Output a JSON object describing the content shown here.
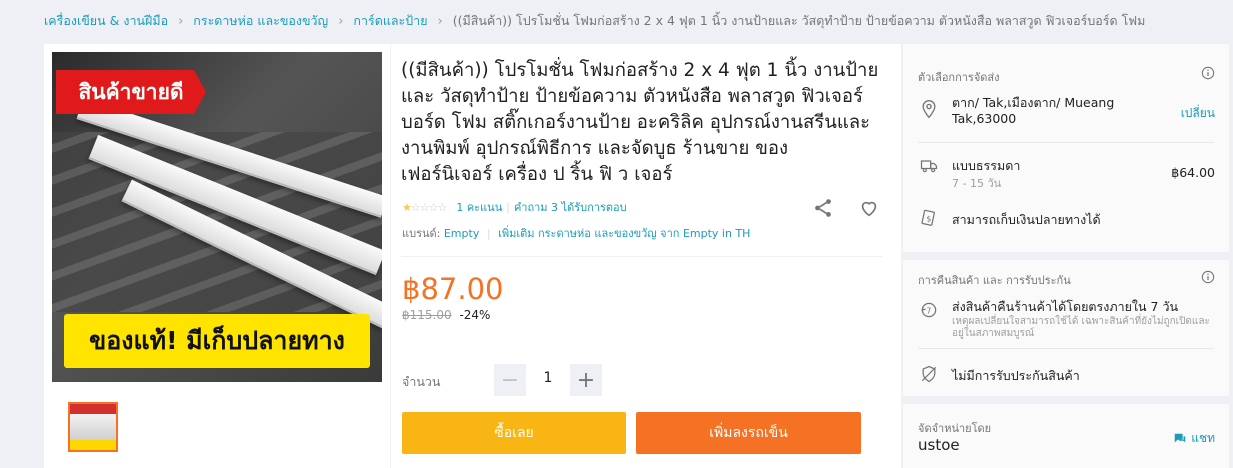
{
  "breadcrumb": {
    "items": [
      "เครื่องเขียน & งานฝีมือ",
      "กระดาษห่อ และของขวัญ",
      "การ์ดและป้าย"
    ],
    "current": "((มีสินค้า)) โปรโมชั่น โฟมก่อสร้าง 2 x 4 ฟุต 1 นิ้ว งานป้ายและ วัสดุทำป้าย ป้ายข้อความ ตัวหนังสือ พลาสวูด ฟิวเจอร์บอร์ด โฟม"
  },
  "gallery": {
    "ribbon_text": "สินค้าขายดี",
    "banner_text": "ของแท้! มีเก็บปลายทาง"
  },
  "product": {
    "title": "((มีสินค้า)) โปรโมชั่น โฟมก่อสร้าง 2 x 4 ฟุต 1 นิ้ว งานป้ายและ วัสดุทำป้าย ป้ายข้อความ ตัวหนังสือ พลาสวูด ฟิวเจอร์บอร์ด โฟม สติ๊กเกอร์งานป้าย อะคริลิค อุปกรณ์งานสรีนและงานพิมพ์ อุปกรณ์พิธีการ และจัดบูธ ร้านขาย ของ เฟอร์นิเจอร์ เครื่อง ป ริ้น ฟิ ว เจอร์",
    "rating_stars": 1,
    "rating_max": 5,
    "ratings_link": "1 คะแนน",
    "questions_link": "คำถาม 3 ได้รับการตอบ",
    "brand_label": "แบรนด์:",
    "brand_value": "Empty",
    "more_link": "เพิ่มเติม กระดาษห่อ และของขวัญ จาก Empty in TH",
    "price": "฿87.00",
    "original_price": "฿115.00",
    "discount": "-24%",
    "quantity_label": "จำนวน",
    "quantity": "1",
    "buy_now_label": "ซื้อเลย",
    "add_to_cart_label": "เพิ่มลงรถเข็น"
  },
  "delivery": {
    "section_label": "ตัวเลือกการจัดส่ง",
    "address": "ตาก/ Tak,เมืองตาก/ Mueang Tak,63000",
    "change_link": "เปลี่ยน",
    "shipping_type": "แบบธรรมดา",
    "shipping_days": "7 - 15 วัน",
    "shipping_price": "฿64.00",
    "cod_text": "สามารถเก็บเงินปลายทางได้"
  },
  "returns": {
    "section_label": "การคืนสินค้า และ การรับประกัน",
    "return_title": "ส่งสินค้าคืนร้านค้าได้โดยตรงภายใน 7 วัน",
    "return_note": "เหตุผลเปลี่ยนใจสามารถใช้ได้ เฉพาะสินค้าที่ยังไม่ถูกเปิดและอยู่ในสภาพสมบูรณ์",
    "warranty_text": "ไม่มีการรับประกันสินค้า"
  },
  "seller": {
    "section_label": "จัดจำหน่ายโดย",
    "name": "ustoe",
    "chat_label": "แชท"
  },
  "colors": {
    "link": "#1a9cb7",
    "price": "#f57224",
    "buy_now": "#f8b514",
    "add_to_cart": "#f57224",
    "star": "#faca51"
  }
}
